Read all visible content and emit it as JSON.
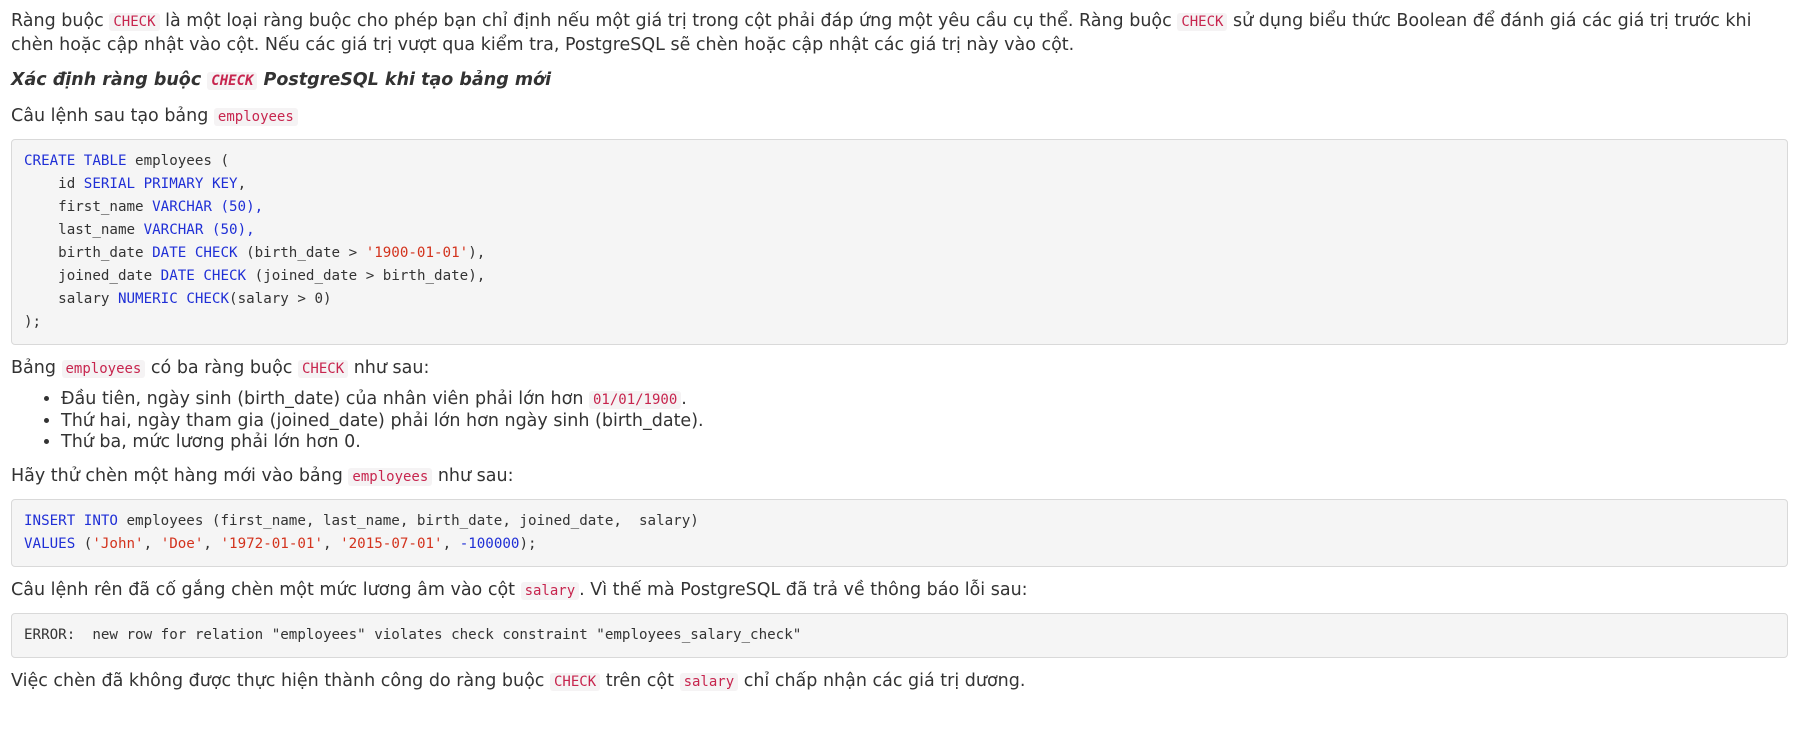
{
  "intro": {
    "t1": "Ràng buộc ",
    "c1": "CHECK",
    "t2": " là một loại ràng buộc cho phép bạn chỉ định nếu một giá trị trong cột phải đáp ứng một yêu cầu cụ thể. Ràng buộc ",
    "c2": "CHECK",
    "t3": " sử dụng biểu thức Boolean để đánh giá các giá trị trước khi chèn hoặc cập nhật vào cột. Nếu các giá trị vượt qua kiểm tra, PostgreSQL sẽ chèn hoặc cập nhật các giá trị này vào cột."
  },
  "heading": {
    "t1": "Xác định ràng buộc ",
    "c1": "CHECK",
    "t2": " PostgreSQL khi tạo bảng mới"
  },
  "create_lead": {
    "t1": "Câu lệnh sau tạo bảng ",
    "c1": "employees"
  },
  "create_code": {
    "l1": [
      "CREATE",
      " ",
      "TABLE",
      " employees ("
    ],
    "l2": [
      "    id ",
      "SERIAL",
      " ",
      "PRIMARY",
      " ",
      "KEY",
      ","
    ],
    "l3": [
      "    first_name ",
      "VARCHAR",
      " (",
      "50",
      "),"
    ],
    "l4": [
      "    last_name ",
      "VARCHAR",
      " (",
      "50",
      "),"
    ],
    "l5": [
      "    birth_date ",
      "DATE",
      " ",
      "CHECK",
      " (birth_date > ",
      "'1900-01-01'",
      "),"
    ],
    "l6": [
      "    joined_date ",
      "DATE",
      " ",
      "CHECK",
      " (joined_date > birth_date),"
    ],
    "l7": [
      "    salary ",
      "NUMERIC",
      " ",
      "CHECK",
      "(salary > ",
      "0",
      ")"
    ],
    "l8": [
      ");"
    ]
  },
  "checks_lead": {
    "t1": "Bảng ",
    "c1": "employees",
    "t2": " có ba ràng buộc ",
    "c2": "CHECK",
    "t3": " như sau:"
  },
  "checks": {
    "i1_t1": "Đầu tiên, ngày sinh (birth_date) của nhân viên phải lớn hơn ",
    "i1_c1": "01/01/1900",
    "i1_t2": ".",
    "i2": "Thứ hai, ngày tham gia (joined_date) phải lớn hơn ngày sinh (birth_date).",
    "i3": "Thứ ba, mức lương phải lớn hơn 0."
  },
  "insert_lead": {
    "t1": "Hãy thử chèn một hàng mới vào bảng ",
    "c1": "employees",
    "t2": " như sau:"
  },
  "insert_code": {
    "l1": [
      "INSERT",
      " ",
      "INTO",
      " employees (first_name, last_name, birth_date, joined_date,  salary)"
    ],
    "l2": [
      "VALUES",
      " (",
      "'John'",
      ", ",
      "'Doe'",
      ", ",
      "'1972-01-01'",
      ", ",
      "'2015-07-01'",
      ", ",
      "-100000",
      ");"
    ]
  },
  "error_lead": {
    "t1": "Câu lệnh rên đã cố gắng chèn một mức lương âm vào cột ",
    "c1": "salary",
    "t2": ". Vì thế mà PostgreSQL đã trả về thông báo lỗi sau:"
  },
  "error_code": {
    "l1": "ERROR:  new row for relation \"employees\" violates check constraint \"employees_salary_check\""
  },
  "conclusion": {
    "t1": "Việc chèn đã không được thực hiện thành công do ràng buộc ",
    "c1": "CHECK",
    "t2": " trên cột ",
    "c2": "salary",
    "t3": " chỉ chấp nhận các giá trị dương."
  },
  "colors": {
    "inline_code": "#c7254e",
    "keyword": "#1f2fd6",
    "string": "#d3331d",
    "code_bg": "#f5f5f5"
  }
}
